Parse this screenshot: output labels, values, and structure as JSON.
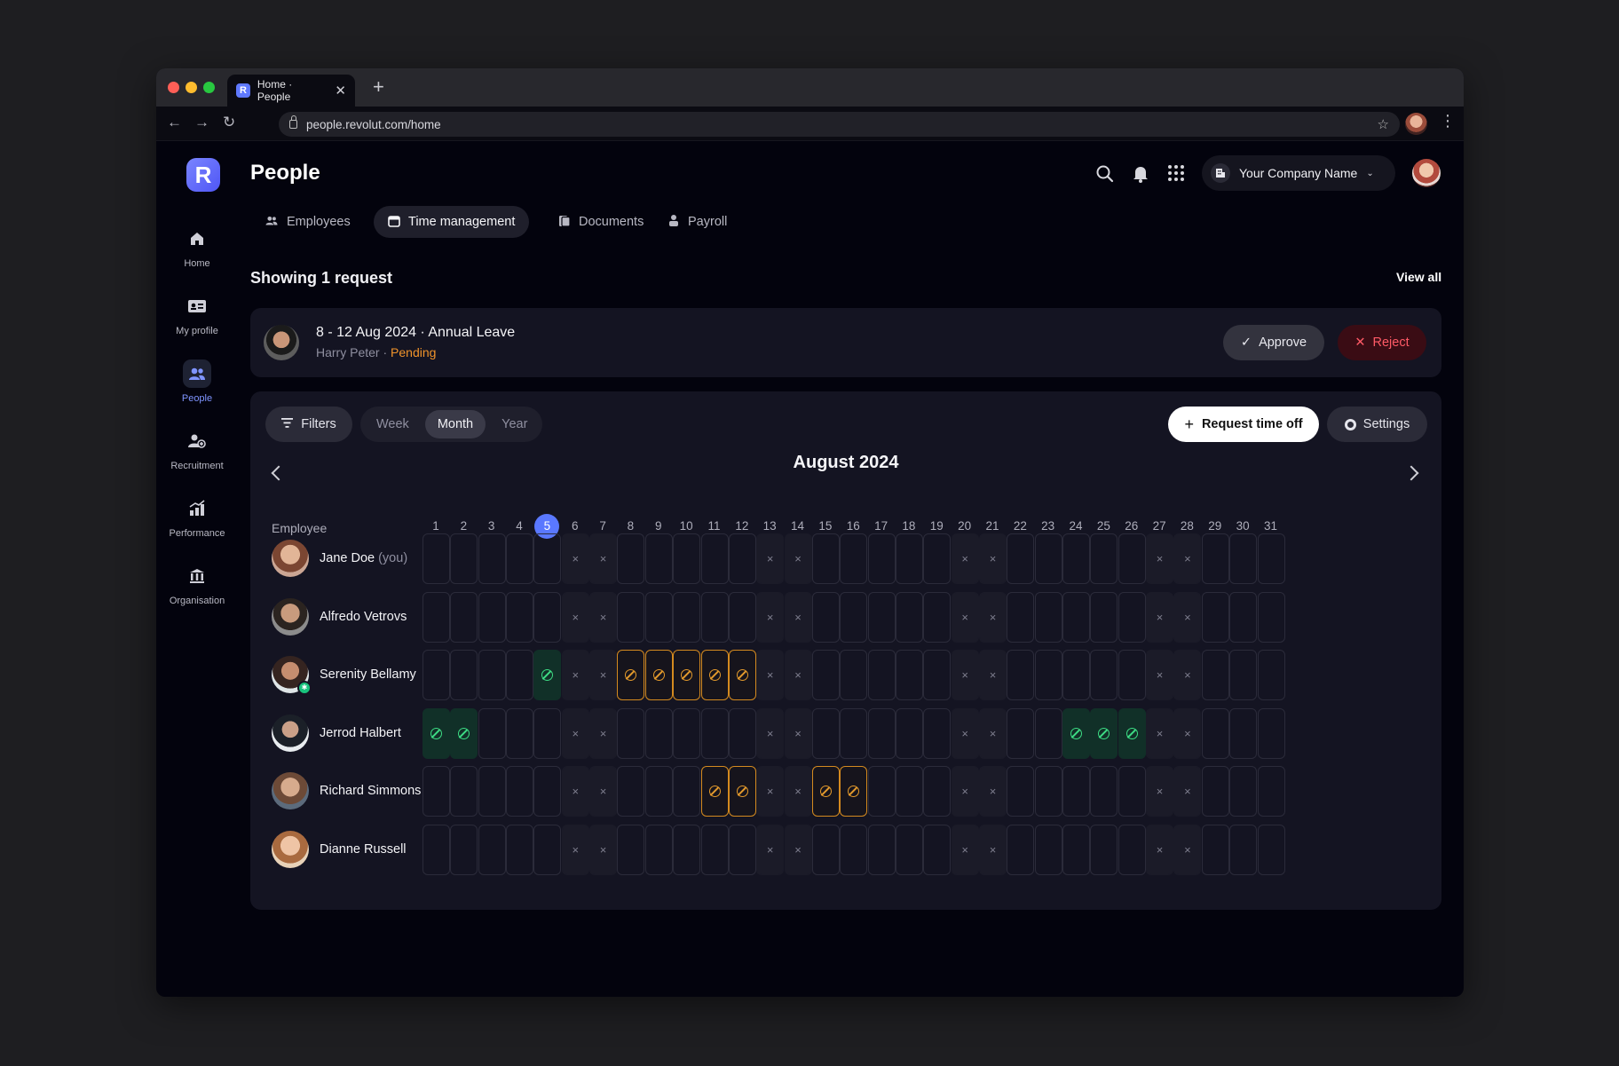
{
  "browser": {
    "tab_title": "Home · People",
    "tab_favicon": "R",
    "url": "people.revolut.com/home"
  },
  "sidebar": {
    "logo": "R",
    "items": [
      {
        "label": "Home",
        "icon": "home-icon"
      },
      {
        "label": "My profile",
        "icon": "id-card-icon"
      },
      {
        "label": "People",
        "icon": "people-icon",
        "active": true
      },
      {
        "label": "Recruitment",
        "icon": "add-user-icon"
      },
      {
        "label": "Performance",
        "icon": "chart-icon"
      },
      {
        "label": "Organisation",
        "icon": "bank-icon"
      }
    ]
  },
  "header": {
    "title": "People",
    "company": "Your Company Name"
  },
  "tabs": [
    {
      "label": "Employees",
      "icon": "people-icon"
    },
    {
      "label": "Time management",
      "icon": "calendar-icon",
      "active": true
    },
    {
      "label": "Documents",
      "icon": "document-icon"
    },
    {
      "label": "Payroll",
      "icon": "money-icon"
    }
  ],
  "requests": {
    "summary": "Showing 1 request",
    "view_all": "View all",
    "item": {
      "title": "8 - 12 Aug 2024 · Annual Leave",
      "name": "Harry Peter",
      "separator": " · ",
      "status": "Pending",
      "approve": "Approve",
      "reject": "Reject"
    }
  },
  "calendar": {
    "filters": "Filters",
    "views": [
      "Week",
      "Month",
      "Year"
    ],
    "active_view": "Month",
    "request_btn": "Request time off",
    "settings_btn": "Settings",
    "month": "August 2024",
    "employee_header": "Employee",
    "today": 5,
    "days": [
      "1",
      "2",
      "3",
      "4",
      "5",
      "6",
      "7",
      "8",
      "9",
      "10",
      "11",
      "12",
      "13",
      "14",
      "15",
      "16",
      "17",
      "18",
      "19",
      "20",
      "21",
      "22",
      "23",
      "24",
      "25",
      "26",
      "27",
      "28",
      "29",
      "30",
      "31"
    ],
    "weekend_days": [
      6,
      7,
      13,
      14,
      20,
      21,
      27,
      28
    ],
    "weekend_mark": "×",
    "colors": {
      "accent": "#5a78ff",
      "approved": "#3ddc84",
      "pending": "#e39a2c",
      "reject": "#ff5a66"
    },
    "employees": [
      {
        "name": "Jane Doe",
        "suffix": " (you)",
        "approved": [],
        "pending": []
      },
      {
        "name": "Alfredo Vetrovs",
        "suffix": "",
        "approved": [],
        "pending": []
      },
      {
        "name": "Serenity Bellamy",
        "suffix": "",
        "approved": [
          5
        ],
        "pending": [
          8,
          9,
          10,
          11,
          12
        ],
        "badge": true
      },
      {
        "name": "Jerrod Halbert",
        "suffix": "",
        "approved": [
          1,
          2,
          24,
          25,
          26
        ],
        "pending": []
      },
      {
        "name": "Richard Simmons",
        "suffix": "",
        "approved": [],
        "pending": [
          11,
          12,
          15,
          16
        ]
      },
      {
        "name": "Dianne Russell",
        "suffix": "",
        "approved": [],
        "pending": []
      }
    ]
  }
}
